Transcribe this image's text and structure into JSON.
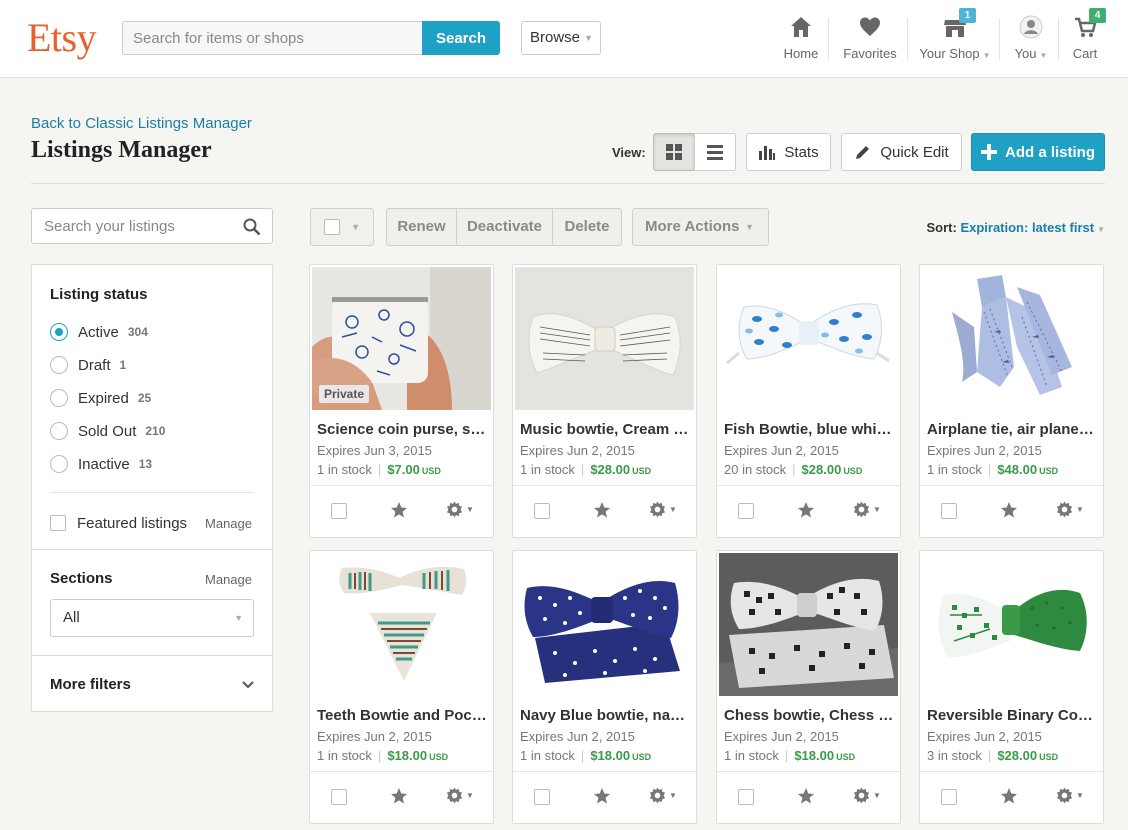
{
  "header": {
    "logo": "Etsy",
    "search_placeholder": "Search for items or shops",
    "search_button": "Search",
    "browse": "Browse",
    "nav": {
      "home": "Home",
      "favorites": "Favorites",
      "your_shop": "Your Shop",
      "your_shop_badge": "1",
      "you": "You",
      "cart": "Cart",
      "cart_badge": "4"
    }
  },
  "page": {
    "back_link": "Back to Classic Listings Manager",
    "title": "Listings Manager",
    "view_label": "View:",
    "stats_button": "Stats",
    "quick_edit_button": "Quick Edit",
    "add_listing_button": "Add a listing"
  },
  "sidebar": {
    "search_placeholder": "Search your listings",
    "listing_status_heading": "Listing status",
    "statuses": [
      {
        "label": "Active",
        "count": "304",
        "selected": true
      },
      {
        "label": "Draft",
        "count": "1",
        "selected": false
      },
      {
        "label": "Expired",
        "count": "25",
        "selected": false
      },
      {
        "label": "Sold Out",
        "count": "210",
        "selected": false
      },
      {
        "label": "Inactive",
        "count": "13",
        "selected": false
      }
    ],
    "featured_label": "Featured listings",
    "featured_manage": "Manage",
    "sections_heading": "Sections",
    "sections_manage": "Manage",
    "sections_value": "All",
    "more_filters": "More filters"
  },
  "actions": {
    "renew": "Renew",
    "deactivate": "Deactivate",
    "delete": "Delete",
    "more_actions": "More Actions",
    "sort_label": "Sort:",
    "sort_value": "Expiration: latest first"
  },
  "listings": [
    {
      "title": "Science coin purse, science",
      "expires": "Expires Jun 3, 2015",
      "stock": "1 in stock",
      "price": "$7.00",
      "currency": "USD",
      "tag": "Private"
    },
    {
      "title": "Music bowtie, Cream bowtie",
      "expires": "Expires Jun 2, 2015",
      "stock": "1 in stock",
      "price": "$28.00",
      "currency": "USD",
      "tag": ""
    },
    {
      "title": "Fish Bowtie, blue white bowtie",
      "expires": "Expires Jun 2, 2015",
      "stock": "20 in stock",
      "price": "$28.00",
      "currency": "USD",
      "tag": ""
    },
    {
      "title": "Airplane tie, air plane tie",
      "expires": "Expires Jun 2, 2015",
      "stock": "1 in stock",
      "price": "$48.00",
      "currency": "USD",
      "tag": ""
    },
    {
      "title": "Teeth Bowtie and Pocket square",
      "expires": "Expires Jun 2, 2015",
      "stock": "1 in stock",
      "price": "$18.00",
      "currency": "USD",
      "tag": ""
    },
    {
      "title": "Navy Blue bowtie, navy bowtie",
      "expires": "Expires Jun 2, 2015",
      "stock": "1 in stock",
      "price": "$18.00",
      "currency": "USD",
      "tag": ""
    },
    {
      "title": "Chess bowtie, Chess pocket square",
      "expires": "Expires Jun 2, 2015",
      "stock": "1 in stock",
      "price": "$18.00",
      "currency": "USD",
      "tag": ""
    },
    {
      "title": "Reversible Binary Computer bowtie",
      "expires": "Expires Jun 2, 2015",
      "stock": "3 in stock",
      "price": "$28.00",
      "currency": "USD",
      "tag": ""
    }
  ],
  "colors": {
    "brand_orange": "#e5622a",
    "accent_blue": "#1fa0c5",
    "price_green": "#3a9a4a",
    "badge_green": "#3fb06c"
  }
}
